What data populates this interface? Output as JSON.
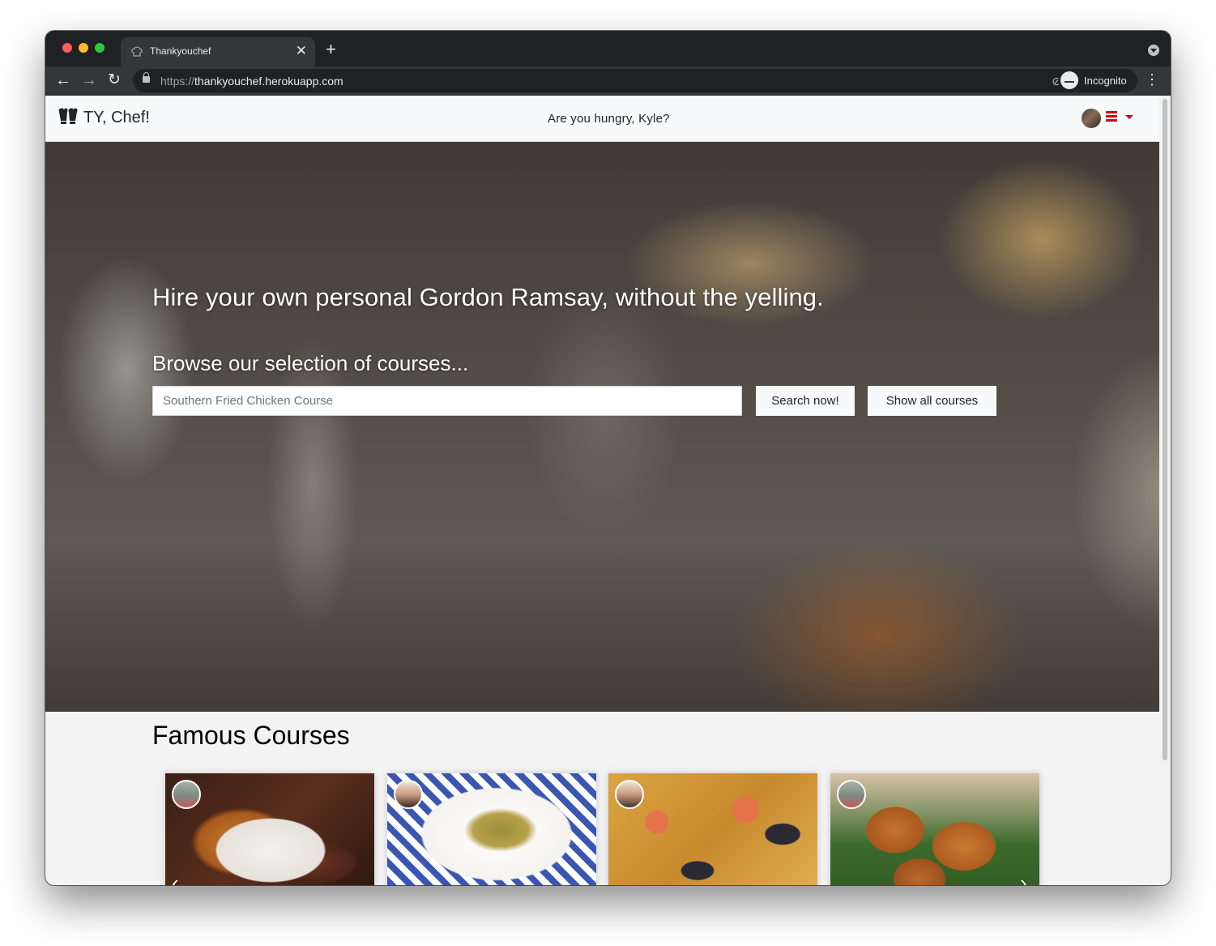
{
  "browser": {
    "tab_title": "Thankyouchef",
    "url_scheme": "https://",
    "url_host": "thankyouchef.herokuapp.com",
    "profile_label": "Incognito",
    "icons": [
      "chef-favicon-icon",
      "close-icon",
      "plus-icon",
      "back-icon",
      "forward-icon",
      "reload-icon",
      "lock-icon",
      "eye-off-icon",
      "star-icon",
      "incognito-icon",
      "kebab-menu-icon",
      "tab-search-icon"
    ]
  },
  "navbar": {
    "brand": "TY, Chef!",
    "greeting": "Are you hungry, Kyle?",
    "menu_icon": "hamburger-icon",
    "accent_color": "#d0021b"
  },
  "hero": {
    "heading": "Hire your own personal Gordon Ramsay, without the yelling.",
    "subheading": "Browse our selection of courses...",
    "search_placeholder": "Southern Fried Chicken Course",
    "search_button": "Search now!",
    "all_button": "Show all courses"
  },
  "courses": {
    "title": "Famous Courses",
    "cards": [
      {
        "image": "steak-and-fries",
        "chef_avatar": "chef-avatar-1"
      },
      {
        "image": "pasta-with-tomatoes",
        "chef_avatar": "chef-avatar-2"
      },
      {
        "image": "seafood-paella",
        "chef_avatar": "chef-avatar-3"
      },
      {
        "image": "fried-chicken",
        "chef_avatar": "chef-avatar-4"
      }
    ]
  }
}
